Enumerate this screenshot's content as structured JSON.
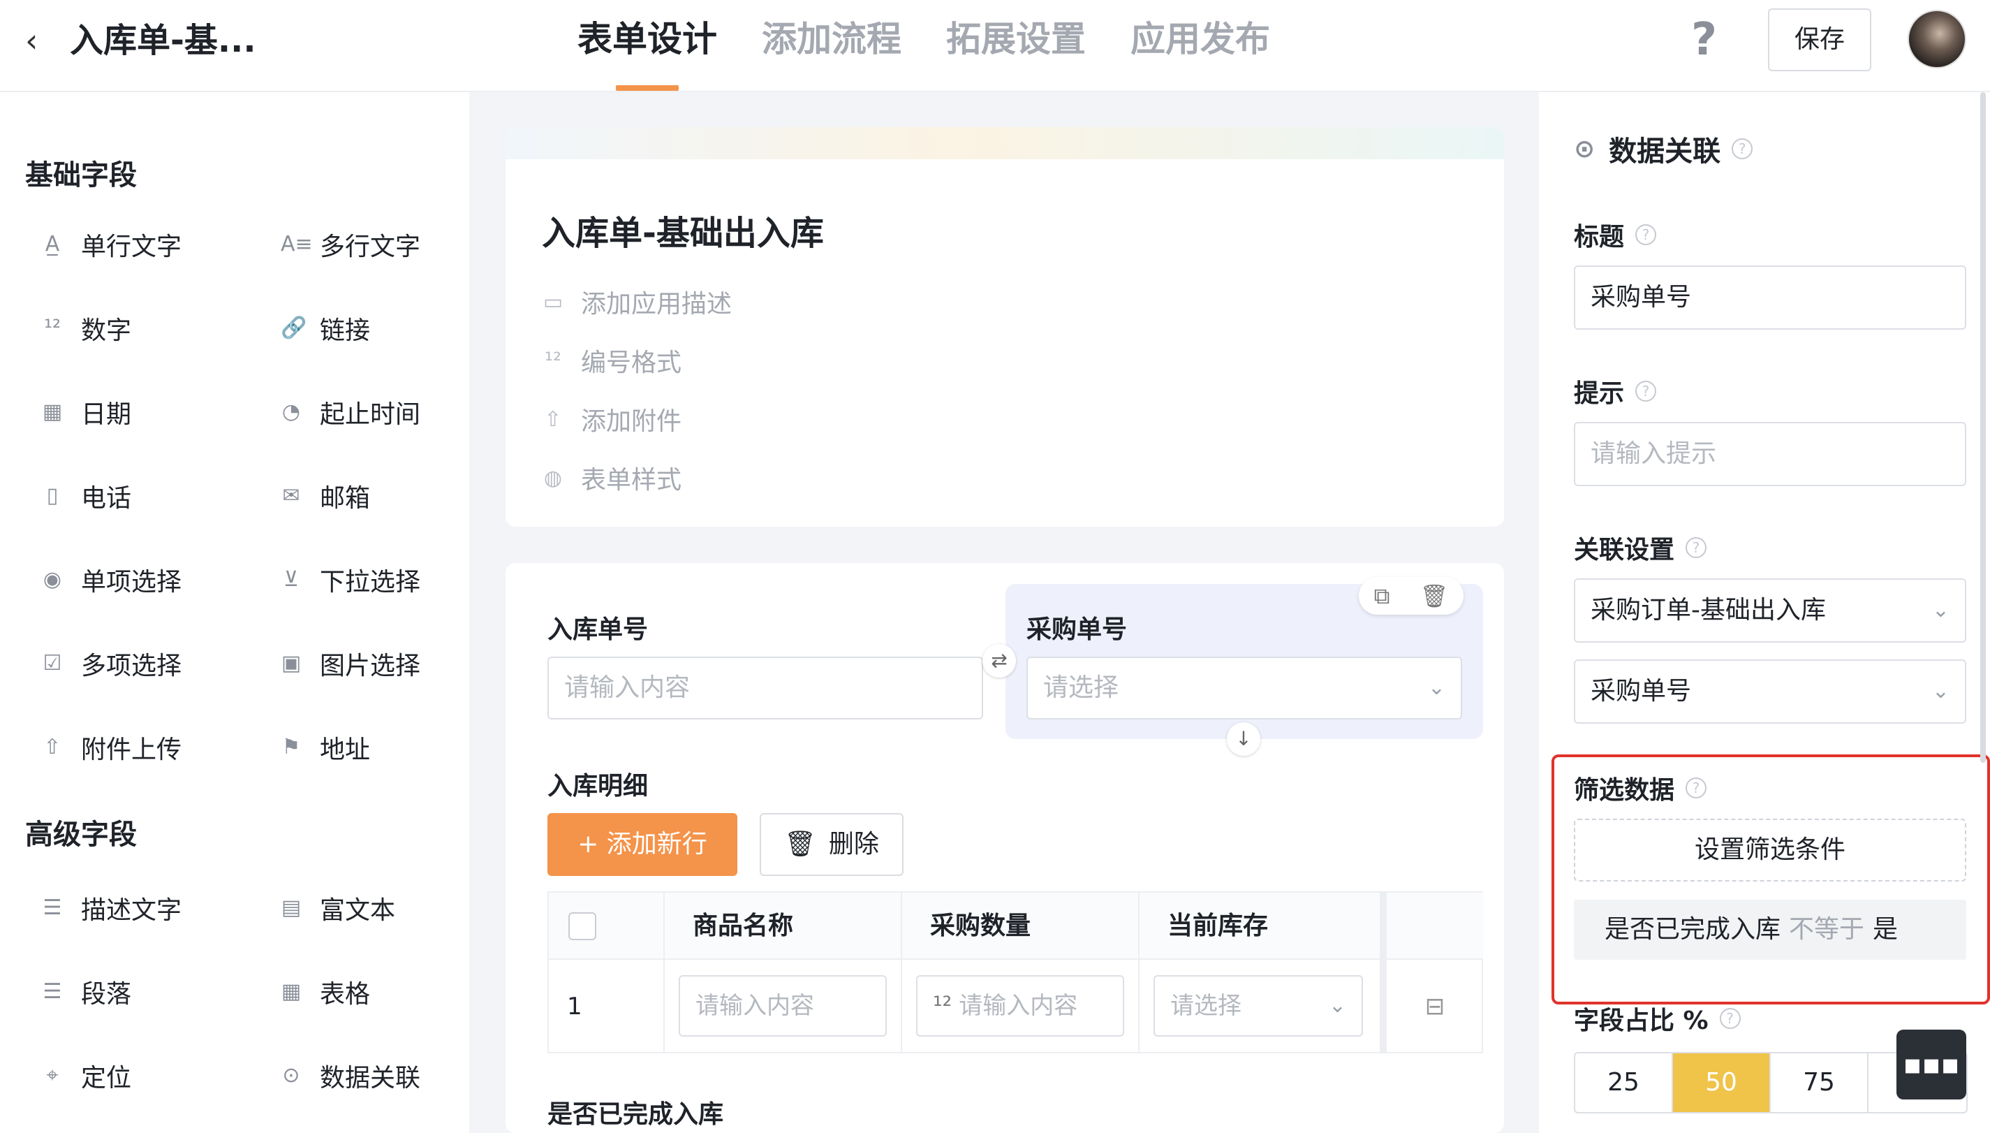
{
  "header": {
    "back_glyph": "‹",
    "app_title": "入库单-基...",
    "tabs": [
      {
        "label": "表单设计",
        "active": true
      },
      {
        "label": "添加流程",
        "active": false
      },
      {
        "label": "拓展设置",
        "active": false
      },
      {
        "label": "应用发布",
        "active": false
      }
    ],
    "help_glyph": "?",
    "save_label": "保存"
  },
  "sidebar": {
    "basic_title": "基础字段",
    "advanced_title": "高级字段",
    "basic_fields": [
      {
        "label": "单行文字",
        "icon": "single-line-text-icon",
        "glyph": "A̲"
      },
      {
        "label": "多行文字",
        "icon": "multi-line-text-icon",
        "glyph": "A≡"
      },
      {
        "label": "数字",
        "icon": "number-icon",
        "glyph": "¹²"
      },
      {
        "label": "链接",
        "icon": "link-icon",
        "glyph": "🔗"
      },
      {
        "label": "日期",
        "icon": "calendar-icon",
        "glyph": "▦"
      },
      {
        "label": "起止时间",
        "icon": "time-range-icon",
        "glyph": "◔"
      },
      {
        "label": "电话",
        "icon": "phone-icon",
        "glyph": "▯"
      },
      {
        "label": "邮箱",
        "icon": "mail-icon",
        "glyph": "✉"
      },
      {
        "label": "单项选择",
        "icon": "radio-icon",
        "glyph": "◉"
      },
      {
        "label": "下拉选择",
        "icon": "dropdown-icon",
        "glyph": "⊻"
      },
      {
        "label": "多项选择",
        "icon": "checkbox-icon",
        "glyph": "☑"
      },
      {
        "label": "图片选择",
        "icon": "image-select-icon",
        "glyph": "▣"
      },
      {
        "label": "附件上传",
        "icon": "upload-icon",
        "glyph": "⇧"
      },
      {
        "label": "地址",
        "icon": "address-icon",
        "glyph": "⚑"
      }
    ],
    "advanced_fields": [
      {
        "label": "描述文字",
        "icon": "description-icon",
        "glyph": "☰"
      },
      {
        "label": "富文本",
        "icon": "rich-text-icon",
        "glyph": "▤"
      },
      {
        "label": "段落",
        "icon": "paragraph-icon",
        "glyph": "☰"
      },
      {
        "label": "表格",
        "icon": "table-icon",
        "glyph": "▦"
      },
      {
        "label": "定位",
        "icon": "location-icon",
        "glyph": "⌖"
      },
      {
        "label": "数据关联",
        "icon": "data-link-icon",
        "glyph": "⊙"
      }
    ]
  },
  "form_header": {
    "title": "入库单-基础出入库",
    "options": [
      {
        "label": "添加应用描述",
        "icon": "comment-icon",
        "glyph": "▭"
      },
      {
        "label": "编号格式",
        "icon": "number-format-icon",
        "glyph": "¹²"
      },
      {
        "label": "添加附件",
        "icon": "upload-icon",
        "glyph": "⇧"
      },
      {
        "label": "表单样式",
        "icon": "palette-icon",
        "glyph": "◍"
      }
    ]
  },
  "form_body": {
    "field1_label": "入库单号",
    "field1_placeholder": "请输入内容",
    "field2_label": "采购单号",
    "field2_placeholder": "请选择",
    "section_label": "入库明细",
    "add_row_label": "+ 添加新行",
    "delete_label": "删除",
    "table": {
      "headers": [
        "商品名称",
        "采购数量",
        "当前库存"
      ],
      "row_index": "1",
      "cells": [
        "请输入内容",
        "请输入内容",
        "请选择"
      ]
    },
    "next_label": "是否已完成入库"
  },
  "right_panel": {
    "title": "数据关联",
    "title_label": "标题",
    "title_value": "采购单号",
    "hint_label": "提示",
    "hint_placeholder": "请输入提示",
    "assoc_label": "关联设置",
    "assoc_form": "采购订单-基础出入库",
    "assoc_field": "采购单号",
    "filter_label": "筛选数据",
    "filter_button": "设置筛选条件",
    "condition": {
      "field": "是否已完成入库",
      "operator": "不等于",
      "value": "是"
    },
    "ratio_label": "字段占比 %",
    "ratio_options": [
      "25",
      "50",
      "75",
      ""
    ],
    "ratio_selected": "50"
  },
  "colors": {
    "accent": "#f4934a",
    "highlight_border": "#e0332b",
    "ratio_active": "#f0c349"
  }
}
